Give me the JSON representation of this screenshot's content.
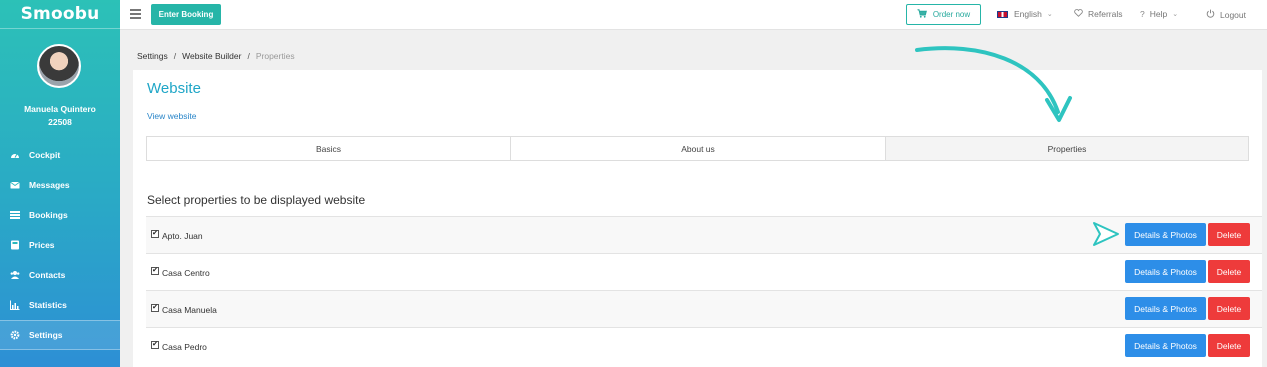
{
  "app": {
    "logo_text": "Smoobu"
  },
  "colors": {
    "brand": "#26b5a8",
    "title_blue": "#1fa6c7",
    "details_blue": "#2d8ee8",
    "delete_red": "#ee3b3b",
    "annotation": "#2ec4c0"
  },
  "user": {
    "name": "Manuela Quintero",
    "id": "22508"
  },
  "sidebar": {
    "items": [
      {
        "label": "Cockpit",
        "icon": "dashboard-icon"
      },
      {
        "label": "Messages",
        "icon": "envelope-icon"
      },
      {
        "label": "Bookings",
        "icon": "list-icon"
      },
      {
        "label": "Prices",
        "icon": "calculator-icon"
      },
      {
        "label": "Contacts",
        "icon": "users-icon"
      },
      {
        "label": "Statistics",
        "icon": "bar-chart-icon"
      },
      {
        "label": "Settings",
        "icon": "gear-icon",
        "active": true
      }
    ]
  },
  "topbar": {
    "enter_booking": "Enter Booking",
    "order_now": "Order now",
    "language": "English",
    "referrals": "Referrals",
    "help_prefix": "?",
    "help": "Help",
    "logout": "Logout"
  },
  "breadcrumb": {
    "items": [
      "Settings",
      "Website Builder"
    ],
    "current": "Properties"
  },
  "page": {
    "title": "Website",
    "view_link": "View website",
    "tabs": [
      {
        "label": "Basics",
        "active": false
      },
      {
        "label": "About us",
        "active": false
      },
      {
        "label": "Properties",
        "active": true
      }
    ],
    "section_title": "Select properties to be displayed website",
    "details_label": "Details & Photos",
    "delete_label": "Delete",
    "properties": [
      {
        "name": "Apto. Juan",
        "checked": true
      },
      {
        "name": "Casa Centro",
        "checked": true
      },
      {
        "name": "Casa Manuela",
        "checked": true
      },
      {
        "name": "Casa Pedro",
        "checked": true
      }
    ]
  }
}
